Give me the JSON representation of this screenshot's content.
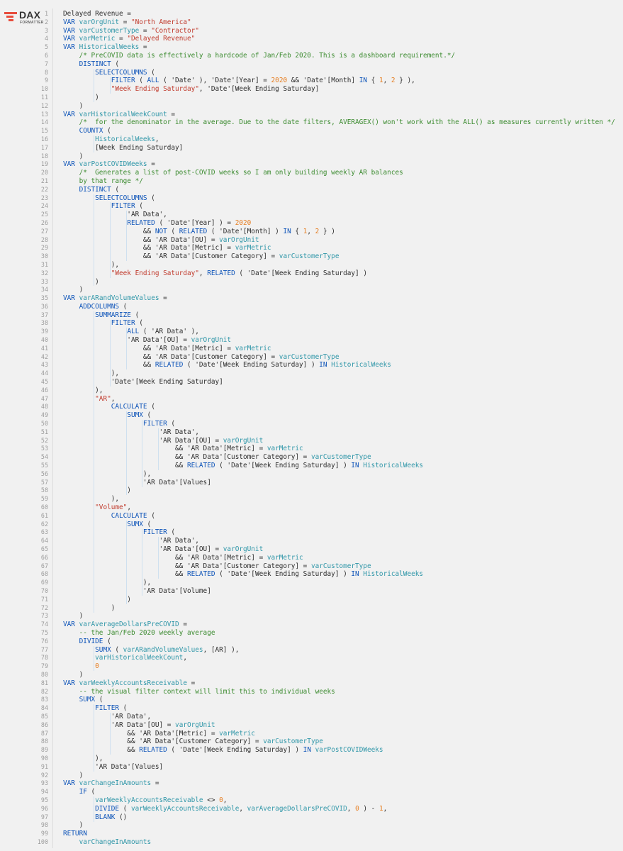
{
  "logo": {
    "title": "DAX",
    "subtitle": "FORMATTER"
  },
  "lines": [
    "Delayed Revenue =",
    "[[k:VAR]] [[v:varOrgUnit]] = [[s:\"North America\"]]",
    "[[k:VAR]] [[v:varCustomerType]] = [[s:\"Contractor\"]]",
    "[[k:VAR]] [[v:varMetric]] = [[s:\"Delayed Revenue\"]]",
    "[[k:VAR]] [[v:HistoricalWeeks]] =",
    "    [[c:/* PreCOVID data is effectively a hardcode of Jan/Feb 2020. This is a dashboard requirement.*/]]",
    "    [[k:DISTINCT]] (",
    "        [[k:SELECTCOLUMNS]] (",
    "            [[k:FILTER]] ( [[k:ALL]] ( 'Date' ), 'Date'[Year] = [[n:2020]] && 'Date'[Month] [[k:IN]] { [[n:1]], [[n:2]] } ),",
    "            [[s:\"Week Ending Saturday\"]], 'Date'[Week Ending Saturday]",
    "        )",
    "    )",
    "[[k:VAR]] [[v:varHistoricalWeekCount]] =",
    "    [[c:/*  for the denominator in the average. Due to the date filters, AVERAGEX() won't work with the ALL() as measures currently written */]]",
    "    [[k:COUNTX]] (",
    "        [[v:HistoricalWeeks]],",
    "        [Week Ending Saturday]",
    "    )",
    "[[k:VAR]] [[v:varPostCOVIDWeeks]] =",
    "    [[c:/*  Generates a list of post-COVID weeks so I am only building weekly AR balances]]",
    "    [[c:by that range */]]",
    "    [[k:DISTINCT]] (",
    "        [[k:SELECTCOLUMNS]] (",
    "            [[k:FILTER]] (",
    "                'AR Data',",
    "                [[k:RELATED]] ( 'Date'[Year] ) = [[n:2020]]",
    "                    && [[k:NOT]] ( [[k:RELATED]] ( 'Date'[Month] ) [[k:IN]] { [[n:1]], [[n:2]] } )",
    "                    && 'AR Data'[OU] = [[v:varOrgUnit]]",
    "                    && 'AR Data'[Metric] = [[v:varMetric]]",
    "                    && 'AR Data'[Customer Category] = [[v:varCustomerType]]",
    "            ),",
    "            [[s:\"Week Ending Saturday\"]], [[k:RELATED]] ( 'Date'[Week Ending Saturday] )",
    "        )",
    "    )",
    "[[k:VAR]] [[v:varARandVolumeValues]] =",
    "    [[k:ADDCOLUMNS]] (",
    "        [[k:SUMMARIZE]] (",
    "            [[k:FILTER]] (",
    "                [[k:ALL]] ( 'AR Data' ),",
    "                'AR Data'[OU] = [[v:varOrgUnit]]",
    "                    && 'AR Data'[Metric] = [[v:varMetric]]",
    "                    && 'AR Data'[Customer Category] = [[v:varCustomerType]]",
    "                    && [[k:RELATED]] ( 'Date'[Week Ending Saturday] ) [[k:IN]] [[v:HistoricalWeeks]]",
    "            ),",
    "            'Date'[Week Ending Saturday]",
    "        ),",
    "        [[s:\"AR\"]],",
    "            [[k:CALCULATE]] (",
    "                [[k:SUMX]] (",
    "                    [[k:FILTER]] (",
    "                        'AR Data',",
    "                        'AR Data'[OU] = [[v:varOrgUnit]]",
    "                            && 'AR Data'[Metric] = [[v:varMetric]]",
    "                            && 'AR Data'[Customer Category] = [[v:varCustomerType]]",
    "                            && [[k:RELATED]] ( 'Date'[Week Ending Saturday] ) [[k:IN]] [[v:HistoricalWeeks]]",
    "                    ),",
    "                    'AR Data'[Values]",
    "                )",
    "            ),",
    "        [[s:\"Volume\"]],",
    "            [[k:CALCULATE]] (",
    "                [[k:SUMX]] (",
    "                    [[k:FILTER]] (",
    "                        'AR Data',",
    "                        'AR Data'[OU] = [[v:varOrgUnit]]",
    "                            && 'AR Data'[Metric] = [[v:varMetric]]",
    "                            && 'AR Data'[Customer Category] = [[v:varCustomerType]]",
    "                            && [[k:RELATED]] ( 'Date'[Week Ending Saturday] ) [[k:IN]] [[v:HistoricalWeeks]]",
    "                    ),",
    "                    'AR Data'[Volume]",
    "                )",
    "            )",
    "    )",
    "[[k:VAR]] [[v:varAverageDollarsPreCOVID]] =",
    "    [[c:-- the Jan/Feb 2020 weekly average]]",
    "    [[k:DIVIDE]] (",
    "        [[k:SUMX]] ( [[v:varARandVolumeValues]], [AR] ),",
    "        [[v:varHistoricalWeekCount]],",
    "        [[n:0]]",
    "    )",
    "[[k:VAR]] [[v:varWeeklyAccountsReceivable]] =",
    "    [[c:-- the visual filter context will limit this to individual weeks]]",
    "    [[k:SUMX]] (",
    "        [[k:FILTER]] (",
    "            'AR Data',",
    "            'AR Data'[OU] = [[v:varOrgUnit]]",
    "                && 'AR Data'[Metric] = [[v:varMetric]]",
    "                && 'AR Data'[Customer Category] = [[v:varCustomerType]]",
    "                && [[k:RELATED]] ( 'Date'[Week Ending Saturday] ) [[k:IN]] [[v:varPostCOVIDWeeks]]",
    "        ),",
    "        'AR Data'[Values]",
    "    )",
    "[[k:VAR]] [[v:varChangeInAmounts]] =",
    "    [[k:IF]] (",
    "        [[v:varWeeklyAccountsReceivable]] <> [[n:0]],",
    "        [[k:DIVIDE]] ( [[v:varWeeklyAccountsReceivable]], [[v:varAverageDollarsPreCOVID]], [[n:0]] ) - [[n:1]],",
    "        [[k:BLANK]] ()",
    "    )",
    "[[k:RETURN]]",
    "    [[v:varChangeInAmounts]]"
  ]
}
